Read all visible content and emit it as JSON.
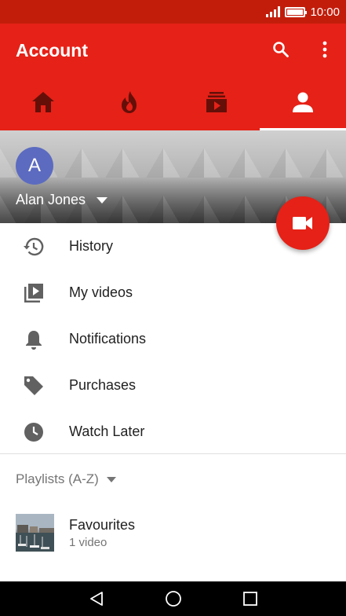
{
  "status_bar": {
    "time": "10:00"
  },
  "app_bar": {
    "title": "Account",
    "actions": [
      "search-icon",
      "more-vert-icon"
    ],
    "tabs": [
      {
        "icon": "home-icon",
        "active": false
      },
      {
        "icon": "trending-icon",
        "active": false
      },
      {
        "icon": "subscriptions-icon",
        "active": false
      },
      {
        "icon": "account-icon",
        "active": true
      }
    ]
  },
  "profile": {
    "avatar_letter": "A",
    "name": "Alan Jones"
  },
  "fab": {
    "icon": "videocam-icon"
  },
  "menu": [
    {
      "icon": "history-icon",
      "label": "History"
    },
    {
      "icon": "my-videos-icon",
      "label": "My videos"
    },
    {
      "icon": "bell-icon",
      "label": "Notifications"
    },
    {
      "icon": "tag-icon",
      "label": "Purchases"
    },
    {
      "icon": "clock-icon",
      "label": "Watch Later"
    }
  ],
  "playlists": {
    "header": "Playlists (A-Z)",
    "items": [
      {
        "title": "Favourites",
        "subtitle": "1 video"
      }
    ]
  },
  "colors": {
    "accent": "#e62117",
    "status_bar": "#c21d0b",
    "avatar": "#5c6bc0"
  }
}
